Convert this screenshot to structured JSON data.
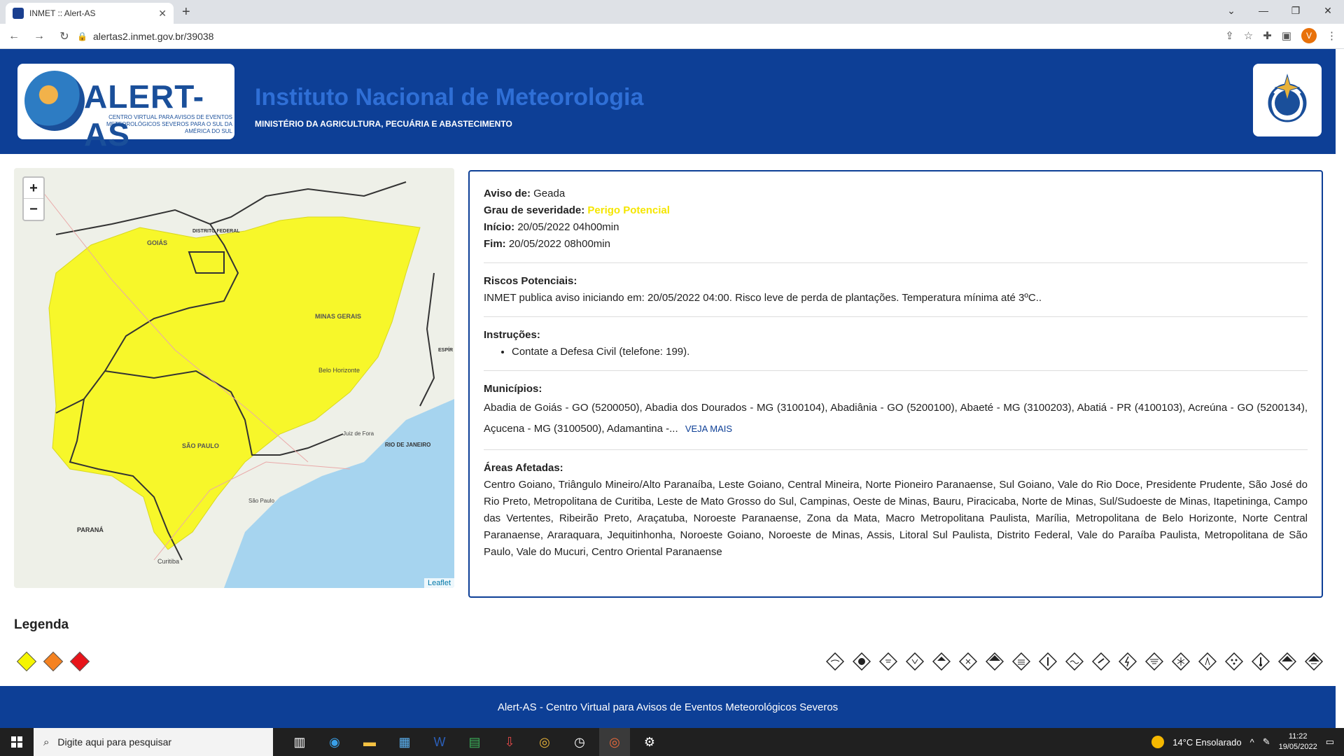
{
  "browser": {
    "tab_title": "INMET :: Alert-AS",
    "url": "alertas2.inmet.gov.br/39038",
    "profile_initial": "V"
  },
  "header": {
    "logo_text": "ALERT-AS",
    "logo_sub": "CENTRO VIRTUAL PARA AVISOS DE EVENTOS METEOROLÓGICOS SEVEROS PARA O SUL DA AMÉRICA DO SUL",
    "title": "Instituto Nacional de Meteorologia",
    "subtitle": "MINISTÉRIO DA AGRICULTURA, PECUÁRIA E ABASTECIMENTO"
  },
  "map": {
    "zoom_in": "+",
    "zoom_out": "−",
    "attribution": "Leaflet",
    "labels": {
      "goias": "GOIÁS",
      "df": "DISTRITO FEDERAL",
      "mg": "MINAS GERAIS",
      "sp": "SÃO PAULO",
      "rj": "RIO DE JANEIRO",
      "pr": "PARANÁ",
      "es": "ESPÍR SANT",
      "bh": "Belo Horizonte",
      "curitiba": "Curitiba",
      "saopaulo": "São Paulo",
      "juizdefora": "Juiz de Fora"
    },
    "alert_color": "#f7f72a"
  },
  "alert": {
    "aviso_label": "Aviso de:",
    "aviso_value": "Geada",
    "grau_label": "Grau de severidade:",
    "grau_value": "Perigo Potencial",
    "inicio_label": "Início:",
    "inicio_value": "20/05/2022 04h00min",
    "fim_label": "Fim:",
    "fim_value": "20/05/2022 08h00min",
    "riscos_title": "Riscos Potenciais:",
    "riscos_text": "INMET publica aviso iniciando em: 20/05/2022 04:00. Risco leve de perda de plantações. Temperatura mínima até 3ºC..",
    "instrucoes_title": "Instruções:",
    "instrucoes_item": "Contate a Defesa Civil (telefone: 199).",
    "municipios_title": "Municípios:",
    "municipios_text": "Abadia de Goiás - GO (5200050), Abadia dos Dourados - MG (3100104), Abadiânia - GO (5200100), Abaeté - MG (3100203), Abatiá - PR (4100103), Acreúna - GO (5200134), Açucena - MG (3100500), Adamantina -...",
    "veja_mais": "VEJA MAIS",
    "areas_title": "Áreas Afetadas:",
    "areas_text": "Centro Goiano, Triângulo Mineiro/Alto Paranaíba, Leste Goiano, Central Mineira, Norte Pioneiro Paranaense, Sul Goiano, Vale do Rio Doce, Presidente Prudente, São José do Rio Preto, Metropolitana de Curitiba, Leste de Mato Grosso do Sul, Campinas, Oeste de Minas, Bauru, Piracicaba, Norte de Minas, Sul/Sudoeste de Minas, Itapetininga, Campo das Vertentes, Ribeirão Preto, Araçatuba, Noroeste Paranaense, Zona da Mata, Macro Metropolitana Paulista, Marília, Metropolitana de Belo Horizonte, Norte Central Paranaense, Araraquara, Jequitinhonha, Noroeste Goiano, Noroeste de Minas, Assis, Litoral Sul Paulista, Distrito Federal, Vale do Paraíba Paulista, Metropolitana de São Paulo, Vale do Mucuri, Centro Oriental Paranaense"
  },
  "legend": {
    "title": "Legenda",
    "colors": [
      "#f5f500",
      "#f58220",
      "#e8141a"
    ]
  },
  "footer": {
    "text": "Alert-AS - Centro Virtual para Avisos de Eventos Meteorológicos Severos"
  },
  "taskbar": {
    "search_placeholder": "Digite aqui para pesquisar",
    "weather": "14°C  Ensolarado",
    "time": "11:22",
    "date": "19/05/2022"
  }
}
